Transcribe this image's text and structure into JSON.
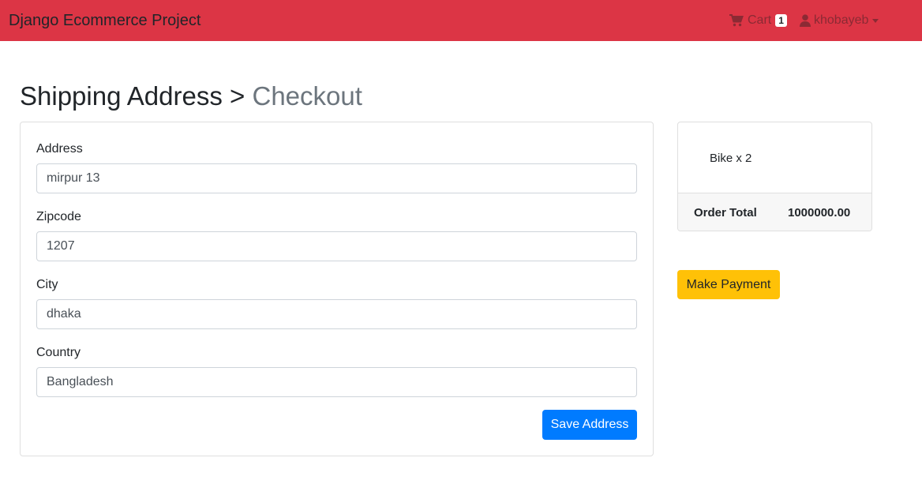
{
  "navbar": {
    "brand": "Django Ecommerce Project",
    "cart_label": "Cart",
    "cart_count": "1",
    "user_name": "khobayeb",
    "color": "#dc3545"
  },
  "page": {
    "title": "Shipping Address",
    "separator": ">",
    "subtitle": "Checkout"
  },
  "form": {
    "fields": [
      {
        "label": "Address",
        "value": "mirpur 13"
      },
      {
        "label": "Zipcode",
        "value": "1207"
      },
      {
        "label": "City",
        "value": "dhaka"
      },
      {
        "label": "Country",
        "value": "Bangladesh"
      }
    ],
    "save_label": "Save Address"
  },
  "summary": {
    "item": "Bike x 2",
    "total_label": "Order Total",
    "total_value": "1000000.00"
  },
  "payment": {
    "button_label": "Make Payment"
  },
  "icons": {
    "cart": "shopping-cart-icon",
    "user": "user-icon",
    "dropdown": "caret-down-icon"
  }
}
